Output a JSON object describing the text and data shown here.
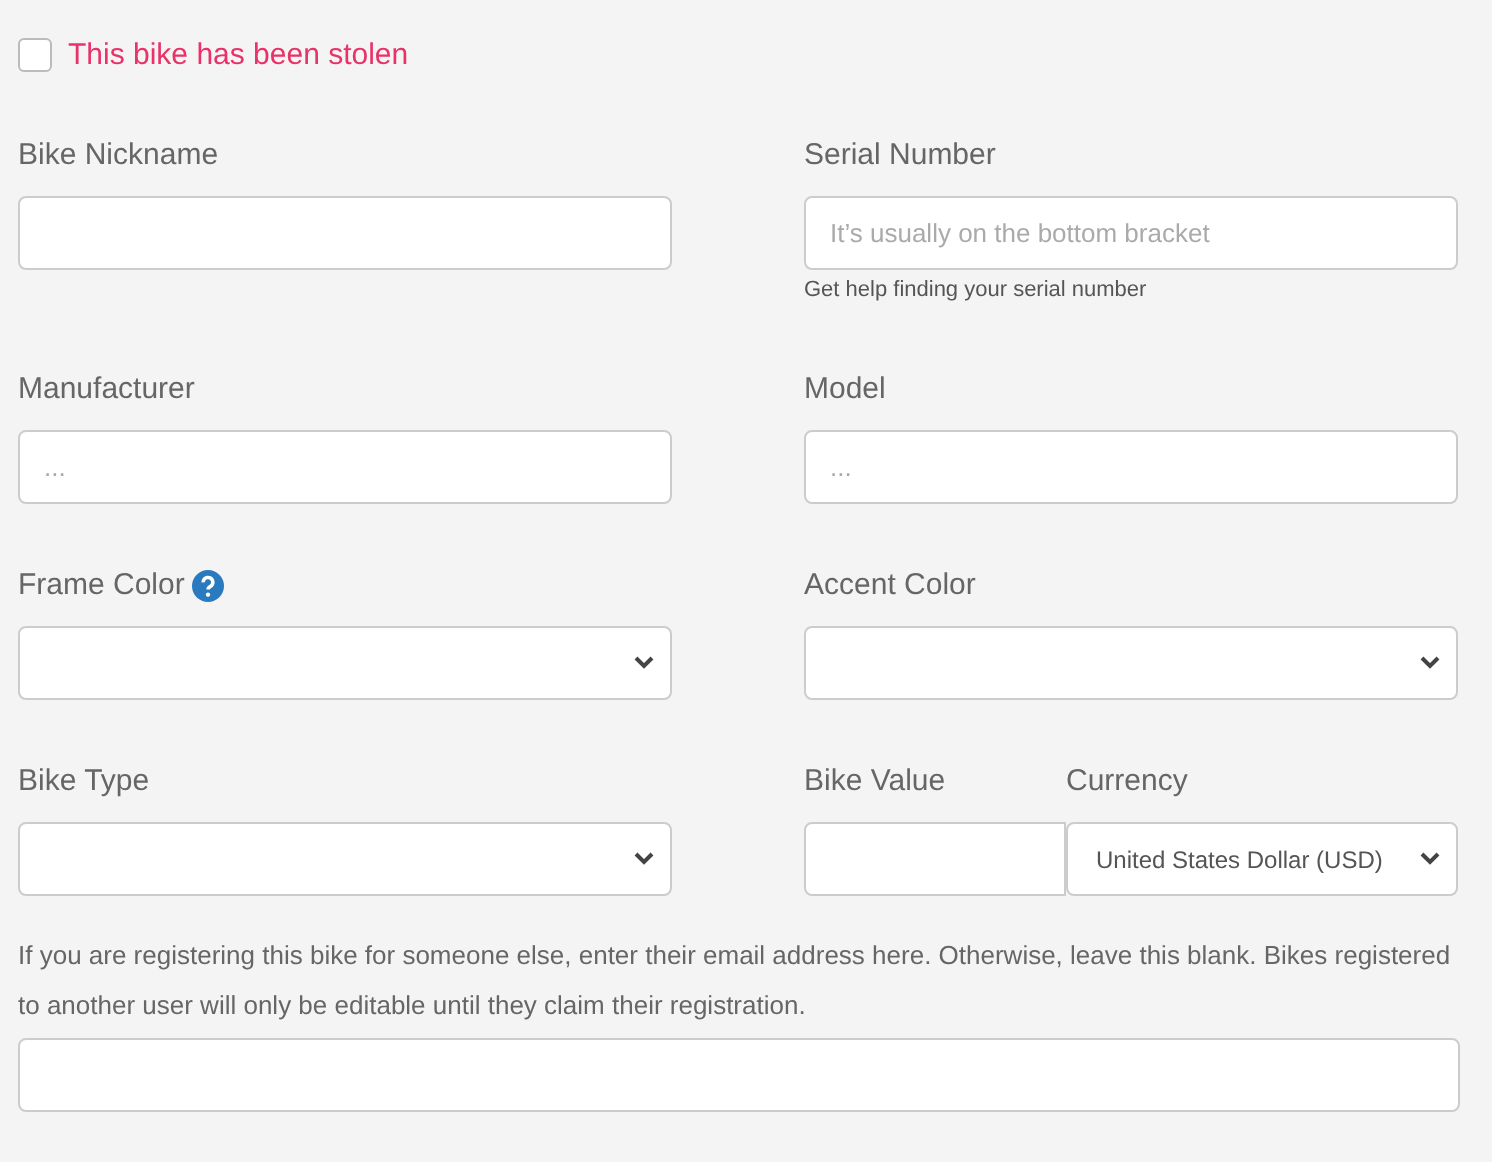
{
  "stolen": {
    "label": "This bike has been stolen",
    "checked": false
  },
  "fields": [
    {
      "kind": "text",
      "label": "Bike Nickname"
    },
    {
      "kind": "text",
      "label": "Serial Number",
      "placeholder": "It’s usually on the bottom bracket",
      "help": "Get help finding your serial number"
    },
    {
      "kind": "text",
      "label": "Manufacturer",
      "placeholder": "..."
    },
    {
      "kind": "text",
      "label": "Model",
      "placeholder": "..."
    },
    {
      "kind": "select",
      "label": "Frame Color",
      "info_icon": true
    },
    {
      "kind": "select",
      "label": "Accent Color",
      "info_icon": false
    },
    {
      "kind": "select",
      "label": "Bike Type",
      "info_icon": false
    },
    {
      "kind": "value_currency",
      "value_label": "Bike Value",
      "currency_label": "Currency",
      "currency_value": "United States Dollar (USD)"
    }
  ],
  "owner_email": {
    "note": "If you are registering this bike for someone else, enter their email address here. Otherwise, leave this blank. Bikes registered to another user will only be editable until they claim their registration."
  }
}
